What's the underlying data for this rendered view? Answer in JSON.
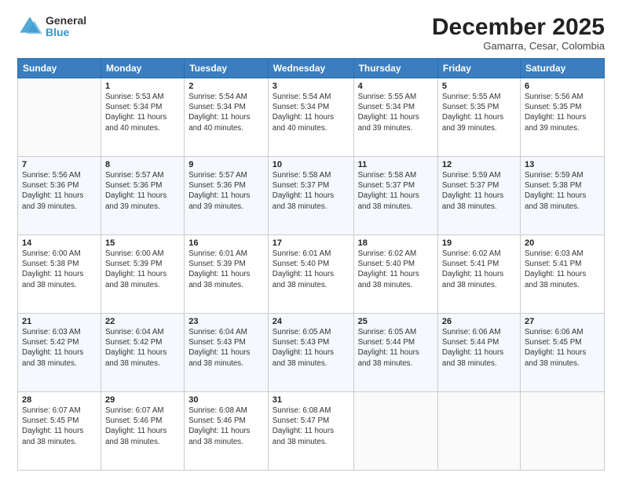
{
  "logo": {
    "general": "General",
    "blue": "Blue"
  },
  "title": "December 2025",
  "subtitle": "Gamarra, Cesar, Colombia",
  "header_days": [
    "Sunday",
    "Monday",
    "Tuesday",
    "Wednesday",
    "Thursday",
    "Friday",
    "Saturday"
  ],
  "weeks": [
    [
      {
        "day": "",
        "info": ""
      },
      {
        "day": "1",
        "info": "Sunrise: 5:53 AM\nSunset: 5:34 PM\nDaylight: 11 hours\nand 40 minutes."
      },
      {
        "day": "2",
        "info": "Sunrise: 5:54 AM\nSunset: 5:34 PM\nDaylight: 11 hours\nand 40 minutes."
      },
      {
        "day": "3",
        "info": "Sunrise: 5:54 AM\nSunset: 5:34 PM\nDaylight: 11 hours\nand 40 minutes."
      },
      {
        "day": "4",
        "info": "Sunrise: 5:55 AM\nSunset: 5:34 PM\nDaylight: 11 hours\nand 39 minutes."
      },
      {
        "day": "5",
        "info": "Sunrise: 5:55 AM\nSunset: 5:35 PM\nDaylight: 11 hours\nand 39 minutes."
      },
      {
        "day": "6",
        "info": "Sunrise: 5:56 AM\nSunset: 5:35 PM\nDaylight: 11 hours\nand 39 minutes."
      }
    ],
    [
      {
        "day": "7",
        "info": "Sunrise: 5:56 AM\nSunset: 5:36 PM\nDaylight: 11 hours\nand 39 minutes."
      },
      {
        "day": "8",
        "info": "Sunrise: 5:57 AM\nSunset: 5:36 PM\nDaylight: 11 hours\nand 39 minutes."
      },
      {
        "day": "9",
        "info": "Sunrise: 5:57 AM\nSunset: 5:36 PM\nDaylight: 11 hours\nand 39 minutes."
      },
      {
        "day": "10",
        "info": "Sunrise: 5:58 AM\nSunset: 5:37 PM\nDaylight: 11 hours\nand 38 minutes."
      },
      {
        "day": "11",
        "info": "Sunrise: 5:58 AM\nSunset: 5:37 PM\nDaylight: 11 hours\nand 38 minutes."
      },
      {
        "day": "12",
        "info": "Sunrise: 5:59 AM\nSunset: 5:37 PM\nDaylight: 11 hours\nand 38 minutes."
      },
      {
        "day": "13",
        "info": "Sunrise: 5:59 AM\nSunset: 5:38 PM\nDaylight: 11 hours\nand 38 minutes."
      }
    ],
    [
      {
        "day": "14",
        "info": "Sunrise: 6:00 AM\nSunset: 5:38 PM\nDaylight: 11 hours\nand 38 minutes."
      },
      {
        "day": "15",
        "info": "Sunrise: 6:00 AM\nSunset: 5:39 PM\nDaylight: 11 hours\nand 38 minutes."
      },
      {
        "day": "16",
        "info": "Sunrise: 6:01 AM\nSunset: 5:39 PM\nDaylight: 11 hours\nand 38 minutes."
      },
      {
        "day": "17",
        "info": "Sunrise: 6:01 AM\nSunset: 5:40 PM\nDaylight: 11 hours\nand 38 minutes."
      },
      {
        "day": "18",
        "info": "Sunrise: 6:02 AM\nSunset: 5:40 PM\nDaylight: 11 hours\nand 38 minutes."
      },
      {
        "day": "19",
        "info": "Sunrise: 6:02 AM\nSunset: 5:41 PM\nDaylight: 11 hours\nand 38 minutes."
      },
      {
        "day": "20",
        "info": "Sunrise: 6:03 AM\nSunset: 5:41 PM\nDaylight: 11 hours\nand 38 minutes."
      }
    ],
    [
      {
        "day": "21",
        "info": "Sunrise: 6:03 AM\nSunset: 5:42 PM\nDaylight: 11 hours\nand 38 minutes."
      },
      {
        "day": "22",
        "info": "Sunrise: 6:04 AM\nSunset: 5:42 PM\nDaylight: 11 hours\nand 38 minutes."
      },
      {
        "day": "23",
        "info": "Sunrise: 6:04 AM\nSunset: 5:43 PM\nDaylight: 11 hours\nand 38 minutes."
      },
      {
        "day": "24",
        "info": "Sunrise: 6:05 AM\nSunset: 5:43 PM\nDaylight: 11 hours\nand 38 minutes."
      },
      {
        "day": "25",
        "info": "Sunrise: 6:05 AM\nSunset: 5:44 PM\nDaylight: 11 hours\nand 38 minutes."
      },
      {
        "day": "26",
        "info": "Sunrise: 6:06 AM\nSunset: 5:44 PM\nDaylight: 11 hours\nand 38 minutes."
      },
      {
        "day": "27",
        "info": "Sunrise: 6:06 AM\nSunset: 5:45 PM\nDaylight: 11 hours\nand 38 minutes."
      }
    ],
    [
      {
        "day": "28",
        "info": "Sunrise: 6:07 AM\nSunset: 5:45 PM\nDaylight: 11 hours\nand 38 minutes."
      },
      {
        "day": "29",
        "info": "Sunrise: 6:07 AM\nSunset: 5:46 PM\nDaylight: 11 hours\nand 38 minutes."
      },
      {
        "day": "30",
        "info": "Sunrise: 6:08 AM\nSunset: 5:46 PM\nDaylight: 11 hours\nand 38 minutes."
      },
      {
        "day": "31",
        "info": "Sunrise: 6:08 AM\nSunset: 5:47 PM\nDaylight: 11 hours\nand 38 minutes."
      },
      {
        "day": "",
        "info": ""
      },
      {
        "day": "",
        "info": ""
      },
      {
        "day": "",
        "info": ""
      }
    ]
  ]
}
